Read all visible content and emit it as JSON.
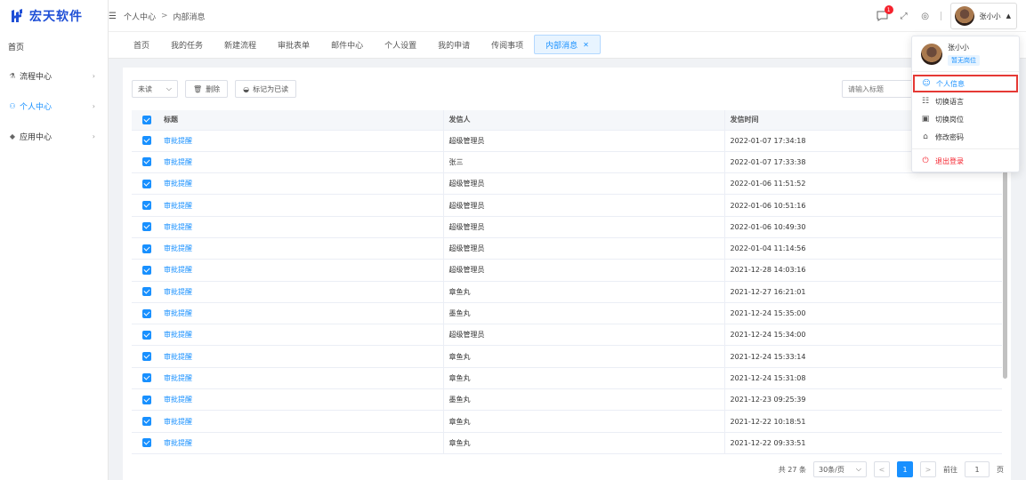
{
  "sidebar": {
    "logo_text": "宏天软件",
    "items": [
      {
        "label": "首页"
      },
      {
        "label": "流程中心"
      },
      {
        "label": "个人中心"
      },
      {
        "label": "应用中心"
      }
    ]
  },
  "header": {
    "breadcrumb": [
      "个人中心",
      "内部消息"
    ],
    "notification_count": "1",
    "user_name": "张小小"
  },
  "tabs": [
    {
      "label": "首页"
    },
    {
      "label": "我的任务"
    },
    {
      "label": "新建流程"
    },
    {
      "label": "审批表单"
    },
    {
      "label": "邮件中心"
    },
    {
      "label": "个人设置"
    },
    {
      "label": "我的申请"
    },
    {
      "label": "传阅事项"
    },
    {
      "label": "内部消息"
    }
  ],
  "toolbar": {
    "filter_value": "未读",
    "delete_label": "删除",
    "mark_read_label": "标记为已读",
    "search_placeholder": "请输入标题"
  },
  "table": {
    "headers": {
      "title": "标题",
      "sender": "发信人",
      "time": "发信时间"
    },
    "rows": [
      {
        "title": "审批提醒",
        "sender": "超级管理员",
        "time": "2022-01-07 17:34:18"
      },
      {
        "title": "审批提醒",
        "sender": "张三",
        "time": "2022-01-07 17:33:38"
      },
      {
        "title": "审批提醒",
        "sender": "超级管理员",
        "time": "2022-01-06 11:51:52"
      },
      {
        "title": "审批提醒",
        "sender": "超级管理员",
        "time": "2022-01-06 10:51:16"
      },
      {
        "title": "审批提醒",
        "sender": "超级管理员",
        "time": "2022-01-06 10:49:30"
      },
      {
        "title": "审批提醒",
        "sender": "超级管理员",
        "time": "2022-01-04 11:14:56"
      },
      {
        "title": "审批提醒",
        "sender": "超级管理员",
        "time": "2021-12-28 14:03:16"
      },
      {
        "title": "审批提醒",
        "sender": "章鱼丸",
        "time": "2021-12-27 16:21:01"
      },
      {
        "title": "审批提醒",
        "sender": "墨鱼丸",
        "time": "2021-12-24 15:35:00"
      },
      {
        "title": "审批提醒",
        "sender": "超级管理员",
        "time": "2021-12-24 15:34:00"
      },
      {
        "title": "审批提醒",
        "sender": "章鱼丸",
        "time": "2021-12-24 15:33:14"
      },
      {
        "title": "审批提醒",
        "sender": "章鱼丸",
        "time": "2021-12-24 15:31:08"
      },
      {
        "title": "审批提醒",
        "sender": "墨鱼丸",
        "time": "2021-12-23 09:25:39"
      },
      {
        "title": "审批提醒",
        "sender": "章鱼丸",
        "time": "2021-12-22 10:18:51"
      },
      {
        "title": "审批提醒",
        "sender": "章鱼丸",
        "time": "2021-12-22 09:33:51"
      }
    ]
  },
  "pagination": {
    "total_text": "共 27 条",
    "page_size": "30条/页",
    "current_page": "1",
    "goto_label": "前往",
    "goto_value": "1",
    "page_unit": "页"
  },
  "dropdown": {
    "user_name": "张小小",
    "role": "暂无岗位",
    "items": [
      {
        "label": "个人信息",
        "icon": "user-icon"
      },
      {
        "label": "切换语言",
        "icon": "language-icon"
      },
      {
        "label": "切换岗位",
        "icon": "id-card-icon"
      },
      {
        "label": "修改密码",
        "icon": "lock-icon"
      }
    ],
    "logout_label": "退出登录"
  },
  "colors": {
    "primary": "#1890ff",
    "brand": "#1f4fd6",
    "danger": "#f5222d",
    "highlight_border": "#e53935"
  }
}
